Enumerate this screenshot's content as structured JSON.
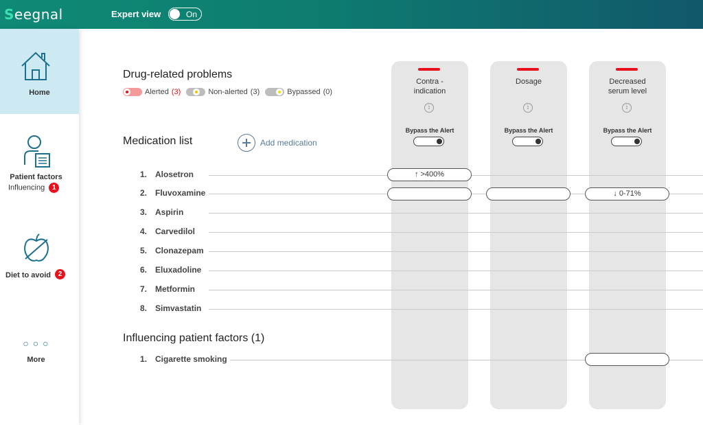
{
  "app": {
    "logo": "eegnal",
    "logo_s": "S"
  },
  "header": {
    "expert_view_label": "Expert view",
    "toggle_text": "On"
  },
  "sidebar": {
    "home_label": "Home",
    "patient_factors_label": "Patient factors",
    "patient_factors_sub": "Influencing",
    "patient_factors_badge": "1",
    "diet_label": "Diet to avoid",
    "diet_badge": "2",
    "more_label": "More",
    "more_icon": "○ ○ ○"
  },
  "drp": {
    "title": "Drug-related problems",
    "legend": [
      {
        "label": "Alerted",
        "count": "(3)"
      },
      {
        "label": "Non-alerted",
        "count": "(3)"
      },
      {
        "label": "Bypassed",
        "count": "(0)"
      }
    ]
  },
  "medication": {
    "title": "Medication list",
    "add_label": "Add medication",
    "items": [
      {
        "num": "1.",
        "name": "Alosetron"
      },
      {
        "num": "2.",
        "name": "Fluvoxamine"
      },
      {
        "num": "3.",
        "name": "Aspirin"
      },
      {
        "num": "4.",
        "name": "Carvedilol"
      },
      {
        "num": "5.",
        "name": "Clonazepam"
      },
      {
        "num": "6.",
        "name": "Eluxadoline"
      },
      {
        "num": "7.",
        "name": "Metformin"
      },
      {
        "num": "8.",
        "name": "Simvastatin"
      }
    ]
  },
  "factors": {
    "title": "Influencing patient factors (1)",
    "items": [
      {
        "num": "1.",
        "name": "Cigarette smoking"
      }
    ]
  },
  "columns": [
    {
      "title_line1": "Contra -",
      "title_line2": "indication",
      "bypass_label": "Bypass the Alert",
      "info": "i"
    },
    {
      "title_line1": "Dosage",
      "title_line2": "",
      "bypass_label": "Bypass the Alert",
      "info": "i"
    },
    {
      "title_line1": "Decreased",
      "title_line2": "serum level",
      "bypass_label": "Bypass the Alert",
      "info": "i"
    }
  ],
  "cells": {
    "c1_alosetron": "↑ >400%",
    "c1_fluvoxamine": "",
    "c2_fluvoxamine": "",
    "c3_fluvoxamine": "↓ 0-71%",
    "c3_smoking": ""
  },
  "colors": {
    "alert_red": "#e8101a",
    "accent_teal": "#0f8a76",
    "home_bg": "#cdeaf3"
  }
}
